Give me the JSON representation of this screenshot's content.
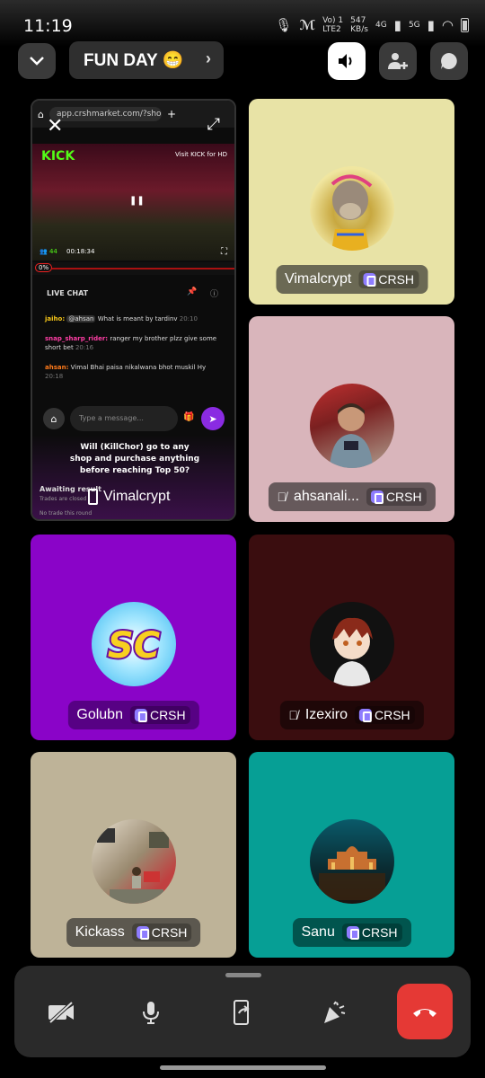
{
  "status_bar": {
    "time": "11:19",
    "net_speed_value": "547",
    "net_speed_unit": "KB/s",
    "carrier_label": "Vo) 1",
    "lte_label": "LTE2",
    "gen1": "4G",
    "gen2": "5G"
  },
  "header": {
    "room_title": "FUN DAY 😁"
  },
  "badge_label": "CRSH",
  "screen_share": {
    "url": "app.crshmarket.com/?show",
    "kick_logo": "KICK",
    "visit_kick": "Visit KICK for HD",
    "viewers": "44",
    "live_time": "00:18:34",
    "progress_label": "0%",
    "live_chat_label": "LIVE CHAT",
    "chat": [
      {
        "user": "jaiho:",
        "mention": "@ahsan",
        "text": "What is meant by tardinv",
        "time": "20:10"
      },
      {
        "user": "snap_sharp_rider:",
        "mention": "",
        "text": "ranger my brother plzz give some short bet",
        "time": "20:16"
      },
      {
        "user": "ahsan:",
        "mention": "",
        "text": "Vimal Bhai paisa nikalwana bhot muskil Hy",
        "time": "20:18"
      }
    ],
    "input_placeholder": "Type a message...",
    "question": "Will (KillChor) go to any shop and purchase anything before reaching Top 50?",
    "awaiting": "Awaiting result",
    "trades_closed": "Trades are closed",
    "no_trade": "No trade this round",
    "sharer": "Vimalcrypt"
  },
  "participants": [
    {
      "name": "Vimalcrypt",
      "muted": false,
      "bg": "#e8e3a6"
    },
    {
      "name": "ahsanali...",
      "muted": true,
      "bg": "#d9b5bb"
    },
    {
      "name": "Golubn",
      "muted": false,
      "bg": "#8a04c8"
    },
    {
      "name": "Izexiro",
      "muted": true,
      "bg": "#3a0d0f"
    },
    {
      "name": "Kickass",
      "muted": false,
      "bg": "#beb398"
    },
    {
      "name": "Sanu",
      "muted": false,
      "bg": "#069f95"
    }
  ],
  "controls": [
    "camera-off",
    "microphone",
    "screen-share",
    "effects",
    "hang-up"
  ]
}
